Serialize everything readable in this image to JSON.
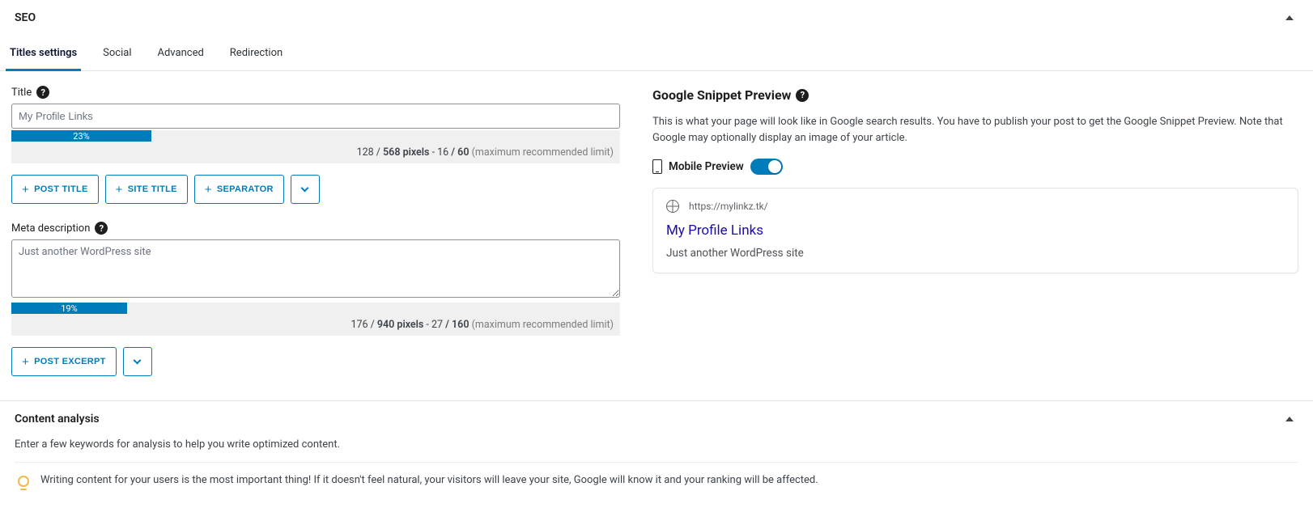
{
  "panel": {
    "title": "SEO"
  },
  "tabs": [
    {
      "label": "Titles settings"
    },
    {
      "label": "Social"
    },
    {
      "label": "Advanced"
    },
    {
      "label": "Redirection"
    }
  ],
  "titleField": {
    "label": "Title",
    "value": "My Profile Links",
    "progressPercent": "23%",
    "progressWidth": "23%",
    "limit": {
      "px_used": "128",
      "px_max": "568",
      "chars_used": "16",
      "chars_max": "60",
      "suffix": "(maximum recommended limit)"
    },
    "buttons": {
      "postTitle": "POST TITLE",
      "siteTitle": "SITE TITLE",
      "separator": "SEPARATOR"
    }
  },
  "metaField": {
    "label": "Meta description",
    "value": "Just another WordPress site",
    "progressPercent": "19%",
    "progressWidth": "19%",
    "limit": {
      "px_used": "176",
      "px_max": "940",
      "chars_used": "27",
      "chars_max": "160",
      "suffix": "(maximum recommended limit)"
    },
    "buttons": {
      "postExcerpt": "POST EXCERPT"
    }
  },
  "preview": {
    "heading": "Google Snippet Preview",
    "desc": "This is what your page will look like in Google search results. You have to publish your post to get the Google Snippet Preview. Note that Google may optionally display an image of your article.",
    "mobileLabel": "Mobile Preview",
    "url": "https://mylinkz.tk/",
    "title": "My Profile Links",
    "snippetDesc": "Just another WordPress site"
  },
  "contentAnalysis": {
    "heading": "Content analysis",
    "prompt": "Enter a few keywords for analysis to help you write optimized content.",
    "hint": "Writing content for your users is the most important thing! If it doesn't feel natural, your visitors will leave your site, Google will know it and your ranking will be affected."
  }
}
